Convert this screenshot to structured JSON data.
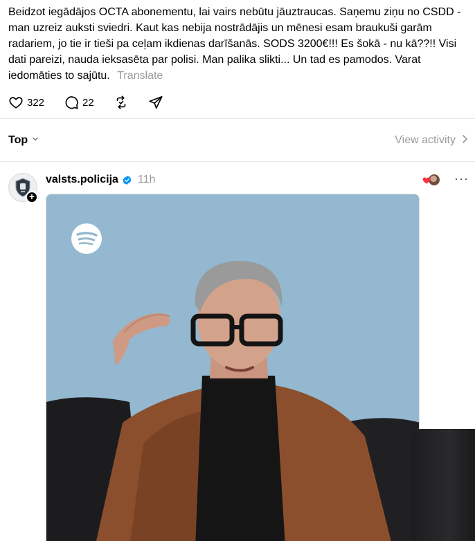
{
  "post": {
    "text": "Beidzot iegādājos OCTA abonementu, lai vairs nebūtu jāuztraucas. Saņemu ziņu no CSDD - man uzreiz auksti sviedri. Kaut kas nebija nostrādājis un mēnesi esam braukuši garām radariem, jo tie ir tieši pa ceļam ikdienas darīšanās. SODS 3200€!!! Es šokā - nu kā??!! Visi dati pareizi, nauda ieksasēta par polisi. Man palika slikti... Un tad es pamodos. Varat iedomāties to sajūtu.",
    "translate_label": "Translate",
    "likes": "322",
    "replies": "22",
    "icons": [
      "heart-icon",
      "comment-icon",
      "repost-icon",
      "share-icon"
    ]
  },
  "sort": {
    "label": "Top",
    "view_activity_label": "View activity"
  },
  "reply": {
    "username": "valsts.policija",
    "time": "11h",
    "verified_color": "#0095f6",
    "liked_heart_color": "#ff3040",
    "media": {
      "badge_icon": "spotify-icon",
      "background_color": "#93b8cf"
    }
  }
}
